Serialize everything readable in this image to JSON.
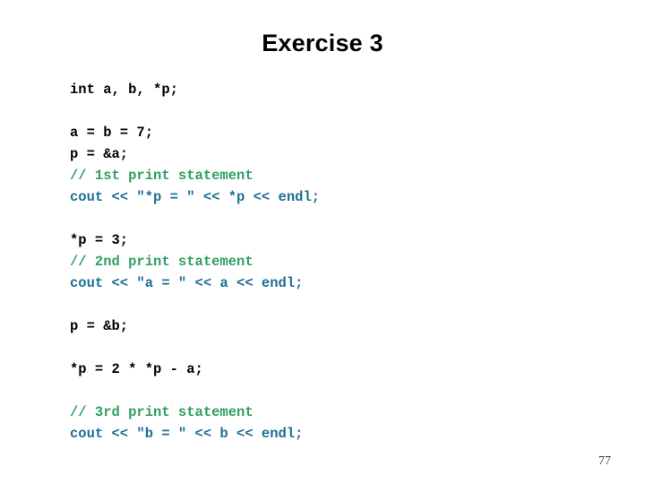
{
  "slide": {
    "title": "Exercise 3",
    "page_number": "77",
    "background_color": "#ffffff",
    "title_color": "#000000",
    "colors": {
      "plain": "#000000",
      "comment": "#2e9f62",
      "stream": "#1e6f94"
    },
    "code_lines": [
      {
        "text": "int a, b, *p;",
        "style": "plain"
      },
      {
        "text": "",
        "style": "blank"
      },
      {
        "text": "a = b = 7;",
        "style": "plain"
      },
      {
        "text": "p = &a;",
        "style": "plain"
      },
      {
        "text": "// 1st print statement",
        "style": "comment"
      },
      {
        "text": "cout << \"*p = \" << *p << endl;",
        "style": "stream"
      },
      {
        "text": "",
        "style": "blank"
      },
      {
        "text": "*p = 3;",
        "style": "plain"
      },
      {
        "text": "// 2nd print statement",
        "style": "comment"
      },
      {
        "text": "cout << \"a = \" << a << endl;",
        "style": "stream"
      },
      {
        "text": "",
        "style": "blank"
      },
      {
        "text": "p = &b;",
        "style": "plain"
      },
      {
        "text": "",
        "style": "blank"
      },
      {
        "text": "*p = 2 * *p - a;",
        "style": "plain"
      },
      {
        "text": "",
        "style": "blank"
      },
      {
        "text": "// 3rd print statement",
        "style": "comment"
      },
      {
        "text": "cout << \"b = \" << b << endl;",
        "style": "stream"
      }
    ]
  }
}
